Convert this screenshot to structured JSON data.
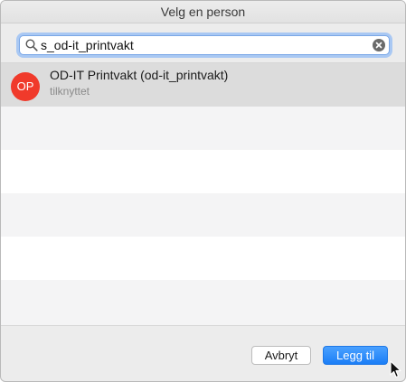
{
  "dialog": {
    "title": "Velg en person"
  },
  "search": {
    "value": "s_od-it_printvakt"
  },
  "results": [
    {
      "initials": "OP",
      "name": "OD-IT Printvakt (od-it_printvakt)",
      "status": "tilknyttet",
      "avatar_color": "#f03a2b"
    }
  ],
  "buttons": {
    "cancel_label": "Avbryt",
    "add_label": "Legg til"
  },
  "colors": {
    "accent": "#1b7ef6",
    "selected_row": "#dcdcdc",
    "alt_row": "#f4f4f5"
  },
  "icons": {
    "search": "magnifier-icon",
    "clear": "clear-circle-x-icon",
    "cursor": "mouse-pointer-icon"
  }
}
